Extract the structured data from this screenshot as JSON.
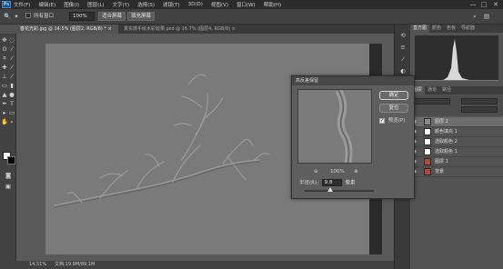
{
  "menubar": {
    "items": [
      "文件(F)",
      "编辑(E)",
      "图像(I)",
      "图层(L)",
      "文字(Y)",
      "选择(S)",
      "滤镜(T)",
      "3D(D)",
      "视图(V)",
      "窗口(W)",
      "帮助(H)"
    ],
    "logo_text": "Ps",
    "min_icon": "—",
    "max_icon": "□",
    "close_icon": "✕"
  },
  "options": {
    "check_label": "所有窗口",
    "zoom_value": "100%",
    "fit_screen": "适合屏幕",
    "fill_screen": "填充屏幕"
  },
  "tabs": [
    {
      "label": "春花光彩.jpg @ 14.5% (图层2, RGB/8) *",
      "close": "×"
    },
    {
      "label": "真实感手绘水彩效果.psd @ 16.7% (图层4, RGB/8)",
      "close": "×"
    }
  ],
  "status": {
    "zoom": "14.51%",
    "doc": "文档:19.9M/89.1M"
  },
  "panels": {
    "top_tabs": [
      "直方图",
      "颜色",
      "色板",
      "导航器"
    ],
    "layer_tabs": [
      "图层",
      "通道",
      "路径"
    ],
    "layers": [
      {
        "name": "图层 2",
        "selected": true,
        "thumb": "#8a8a8a"
      },
      {
        "name": "颜色填充 1",
        "selected": false,
        "thumb": "#ffffff"
      },
      {
        "name": "选取颜色 2",
        "selected": false,
        "thumb": "#ffffff"
      },
      {
        "name": "选取颜色 1",
        "selected": false,
        "thumb": "#ffffff"
      },
      {
        "name": "图层 1",
        "selected": false,
        "thumb": "#b04a3a"
      },
      {
        "name": "背景",
        "selected": false,
        "thumb": "#b04a3a"
      }
    ]
  },
  "dialog": {
    "title": "高反差保留",
    "ok": "确定",
    "reset": "复位",
    "preview_label": "预览(P)",
    "preview_checked": "✓",
    "zoom_out": "⊖",
    "zoom_value": "100%",
    "zoom_in": "⊕",
    "radius_label": "半径(R):",
    "radius_value": "9.8",
    "radius_unit": "像素"
  },
  "colors": {
    "accent": "#3d8cc8",
    "canvas_gray": "#7a7a7a",
    "panel_dark": "#424242"
  }
}
